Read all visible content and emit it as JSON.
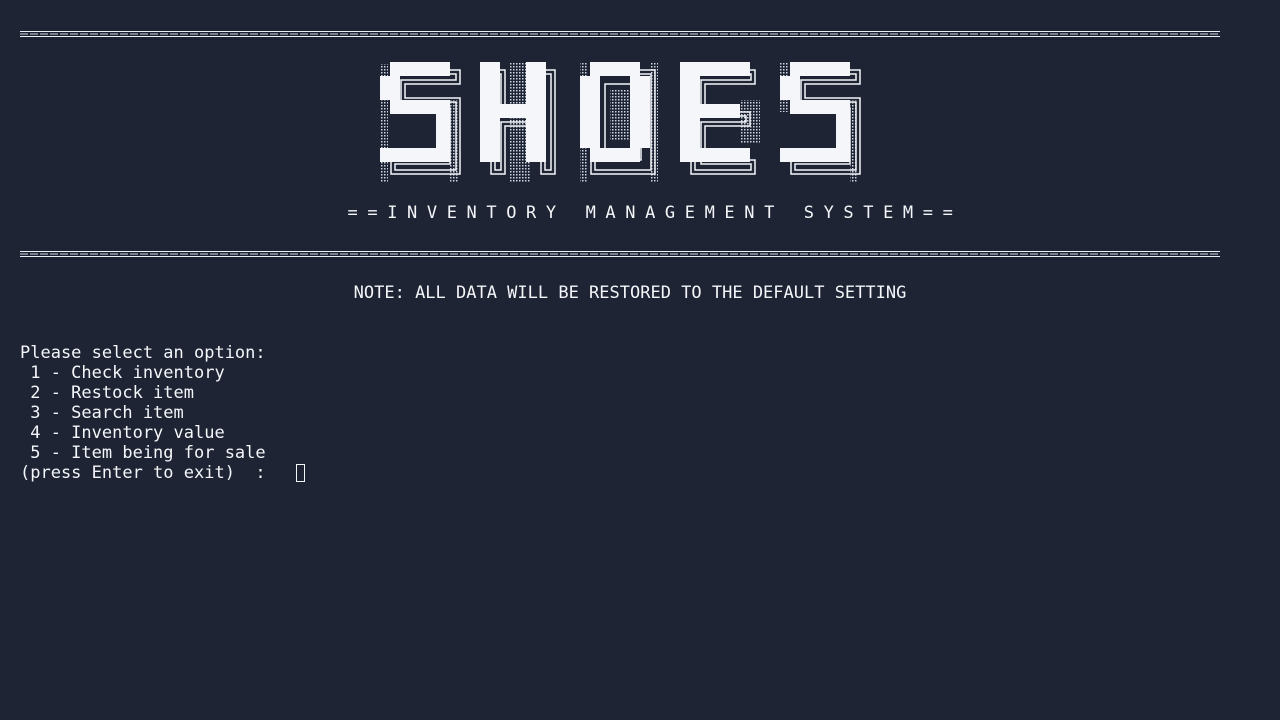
{
  "header": {
    "banner_text": "SHOES",
    "subtitle": "==INVENTORY MANAGEMENT SYSTEM=="
  },
  "note": "NOTE: ALL DATA WILL BE RESTORED TO THE DEFAULT SETTING",
  "menu": {
    "prompt": "Please select an option:",
    "items": [
      " 1 - Check inventory",
      " 2 - Restock item",
      " 3 - Search item",
      " 4 - Inventory value",
      " 5 - Item being for sale"
    ],
    "exit_hint": "(press Enter to exit)  :"
  },
  "colors": {
    "background": "#1e2433",
    "foreground": "#f4f6fa"
  }
}
